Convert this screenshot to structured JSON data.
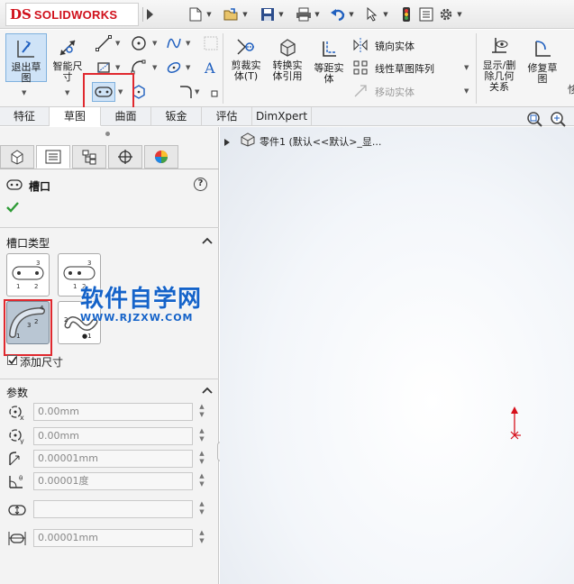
{
  "app": {
    "brand_prefix": "DS",
    "brand_name": "SOLIDWORKS"
  },
  "ribbon": {
    "exit_sketch": "退出草\n图",
    "smart_dim": "智能尺\n寸",
    "trim": "剪裁实\n体(T)",
    "convert": "转换实\n体引用",
    "offset": "等距实\n体",
    "mirror": "镜向实体",
    "linear_pattern": "线性草图阵列",
    "move": "移动实体",
    "show_delete": "显示/删\n除几何\n关系",
    "repair": "修复草\n图"
  },
  "tabs": [
    "特征",
    "草图",
    "曲面",
    "钣金",
    "评估",
    "DimXpert"
  ],
  "tree": {
    "root": "零件1  (默认<<默认>_显..."
  },
  "panel": {
    "title": "槽口",
    "slot_type_title": "槽口类型",
    "add_dimension": "添加尺寸",
    "params_title": "参数",
    "fields": [
      "0.00mm",
      "0.00mm",
      "0.00001mm",
      "0.00001度",
      "",
      "0.00001mm"
    ]
  },
  "watermark": {
    "line1": "软件自学网",
    "line2": "WWW.RJZXW.COM"
  },
  "colors": {
    "accent_red": "#e0282e",
    "brand_red": "#d0101b",
    "watermark_blue": "#1563c9"
  }
}
